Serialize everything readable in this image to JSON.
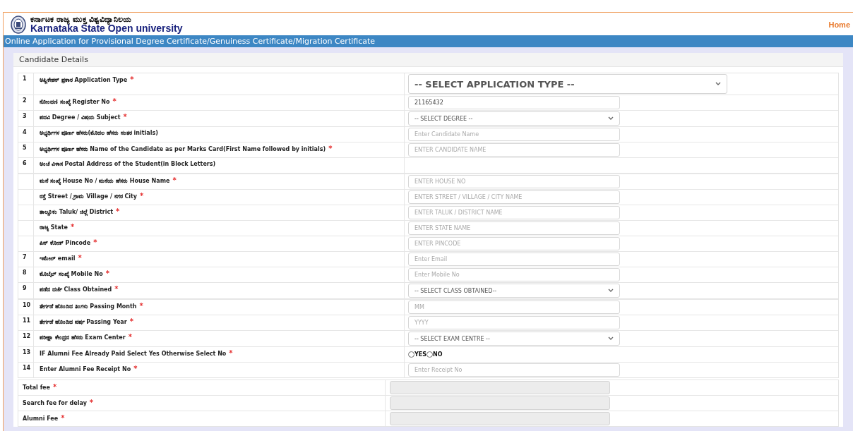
{
  "header": {
    "title_kannada": "ಕರ್ನಾಟಕ ರಾಜ್ಯ ಮುಕ್ತ ವಿಶ್ವವಿದ್ಯಾನಿಲಯ",
    "title_english": "Karnataka State Open university",
    "home_link": "Home"
  },
  "banner": "Online Application for Provisional Degree Certificate/Genuiness Certificate/Migration Certificate",
  "section_title": "Candidate Details",
  "required_mark": "*",
  "rows": [
    {
      "number": "1",
      "label": "ಅಪ್ಲಿಕೇಶನ್ ಪ್ರಕಾರ Application Type",
      "required": true,
      "kind": "select-large",
      "value": "-- SELECT APPLICATION TYPE --"
    },
    {
      "number": "2",
      "label": "ನೋಂದಣಿ ಸಂಖ್ಯೆ Register No",
      "required": true,
      "kind": "input",
      "value": "21165432"
    },
    {
      "number": "3",
      "label": "ಪದವಿ Degree / ವಿಷಯ Subject",
      "required": true,
      "kind": "select",
      "value": "-- SELECT DEGREE --"
    },
    {
      "number": "4",
      "label": "ಅಭ್ಯರ್ಥಿಗಳ ಪೂರ್ಣ ಹೆಸರು(ಮೊದಲ ಹೆಸರು ನಂತರ initials)",
      "required": false,
      "kind": "input",
      "placeholder": "Enter Candidate Name"
    },
    {
      "number": "5",
      "label": "ಅಭ್ಯರ್ಥಿಗಳ ಪೂರ್ಣ ಹೆಸರು Name of the Candidate as per Marks Card(First Name followed by initials)",
      "required": true,
      "kind": "input",
      "placeholder": "ENTER CANDIDATE NAME"
    },
    {
      "number": "6",
      "label": "ಅಂಚೆ ವಿಳಾಸ Postal Address of the Student(in Block Letters)",
      "required": false,
      "kind": "heading"
    },
    {
      "label": "ಮನೆ ಸಂಖ್ಯೆ House No / ಮನೆಯ ಹೆಸರು House Name",
      "required": true,
      "kind": "input",
      "placeholder": "ENTER HOUSE NO"
    },
    {
      "label": "ರಸ್ತೆ Street / ಗ್ರಾಮ Village / ನಗರ City",
      "required": true,
      "kind": "input",
      "placeholder": "ENTER STREET / VILLAGE / CITY NAME"
    },
    {
      "label": "ತಾಲ್ಲೂಕು Taluk/ ಜಿಲ್ಲೆ District",
      "required": true,
      "kind": "input",
      "placeholder": "ENTER TALUK / DISTRICT NAME"
    },
    {
      "label": "ರಾಜ್ಯ State",
      "required": true,
      "kind": "input",
      "placeholder": "ENTER STATE NAME"
    },
    {
      "label": "ಪಿನ್ ಕೋಡ್ Pincode",
      "required": true,
      "kind": "input",
      "placeholder": "ENTER PINCODE"
    },
    {
      "number": "7",
      "label": "ಇಮೇಲ್ email",
      "required": true,
      "kind": "input",
      "placeholder": "Enter Email"
    },
    {
      "number": "8",
      "label": "ಮೊಬೈಲ್ ಸಂಖ್ಯೆ Mobile No",
      "required": true,
      "kind": "input",
      "placeholder": "Enter Mobile No"
    },
    {
      "number": "9",
      "label": "ಪಡೆದ ದರ್ಜೆ Class Obtained",
      "required": true,
      "kind": "select",
      "value": "-- SELECT CLASS OBTAINED--"
    },
    {
      "number": "10",
      "label": "ತೇರ್ಗಡೆ ಹೊಂದಿದ ತಿಂಗಳು Passing Month",
      "required": true,
      "kind": "input",
      "placeholder": "MM"
    },
    {
      "number": "11",
      "label": "ತೇರ್ಗಡೆ ಹೊಂದಿದ ವರ್ಷ Passing Year",
      "required": true,
      "kind": "input",
      "placeholder": "YYYY"
    },
    {
      "number": "12",
      "label": "ಪರೀಕ್ಷಾ ಕೇಂದ್ರದ ಹೆಸರು Exam Center",
      "required": true,
      "kind": "select",
      "value": "-- SELECT EXAM CENTRE --"
    },
    {
      "number": "13",
      "label": "IF Alumni Fee Already Paid Select Yes Otherwise Select No",
      "required": true,
      "kind": "radio",
      "options": [
        {
          "label": "YES",
          "selected": false
        },
        {
          "label": "NO",
          "selected": false
        }
      ]
    },
    {
      "number": "14",
      "label": "Enter Alumni Fee Receipt No",
      "required": true,
      "kind": "input",
      "placeholder": "Enter Receipt No"
    }
  ],
  "fees": [
    {
      "label": "Total fee",
      "required": true
    },
    {
      "label": "Search fee for delay",
      "required": true
    },
    {
      "label": "Alumni Fee",
      "required": true
    }
  ]
}
